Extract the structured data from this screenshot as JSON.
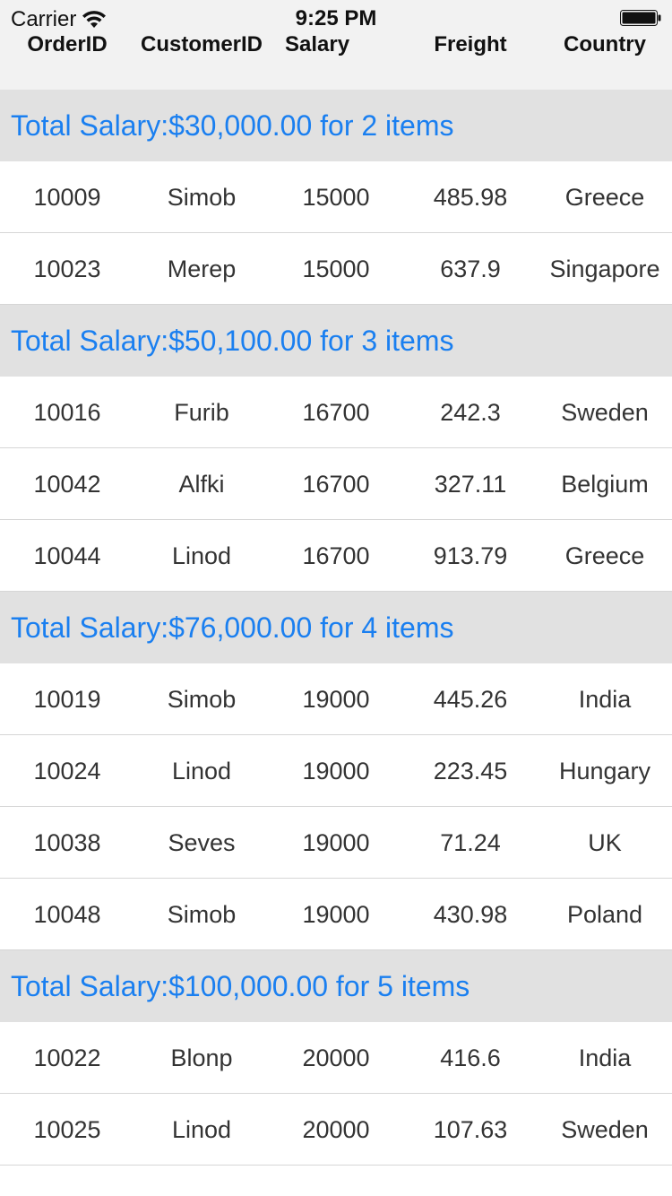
{
  "status_bar": {
    "carrier": "Carrier",
    "time": "9:25 PM",
    "wifi_icon": "wifi-icon",
    "battery_icon": "battery-icon"
  },
  "columns": [
    "OrderID",
    "CustomerID",
    "Salary",
    "Freight",
    "Country"
  ],
  "colors": {
    "group_header_text": "#1a7ff0",
    "group_header_bg": "#e1e1e1",
    "header_bg": "#f2f2f2"
  },
  "groups": [
    {
      "title": "Total Salary:$30,000.00 for 2 items",
      "rows": [
        [
          "10009",
          "Simob",
          "15000",
          "485.98",
          "Greece"
        ],
        [
          "10023",
          "Merep",
          "15000",
          "637.9",
          "Singapore"
        ]
      ]
    },
    {
      "title": "Total Salary:$50,100.00 for 3 items",
      "rows": [
        [
          "10016",
          "Furib",
          "16700",
          "242.3",
          "Sweden"
        ],
        [
          "10042",
          "Alfki",
          "16700",
          "327.11",
          "Belgium"
        ],
        [
          "10044",
          "Linod",
          "16700",
          "913.79",
          "Greece"
        ]
      ]
    },
    {
      "title": "Total Salary:$76,000.00 for 4 items",
      "rows": [
        [
          "10019",
          "Simob",
          "19000",
          "445.26",
          "India"
        ],
        [
          "10024",
          "Linod",
          "19000",
          "223.45",
          "Hungary"
        ],
        [
          "10038",
          "Seves",
          "19000",
          "71.24",
          "UK"
        ],
        [
          "10048",
          "Simob",
          "19000",
          "430.98",
          "Poland"
        ]
      ]
    },
    {
      "title": "Total Salary:$100,000.00 for 5 items",
      "rows": [
        [
          "10022",
          "Blonp",
          "20000",
          "416.6",
          "India"
        ],
        [
          "10025",
          "Linod",
          "20000",
          "107.63",
          "Sweden"
        ]
      ]
    }
  ]
}
